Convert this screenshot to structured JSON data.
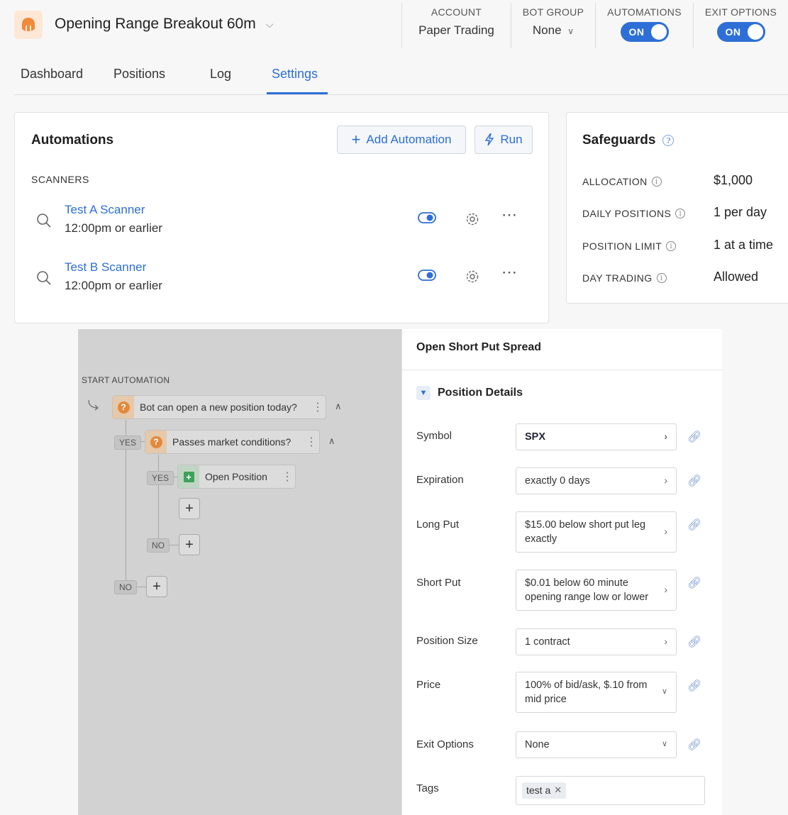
{
  "bot": {
    "name": "Opening Range Breakout 60m"
  },
  "header": {
    "account": {
      "label": "ACCOUNT",
      "value": "Paper Trading"
    },
    "bot_group": {
      "label": "BOT GROUP",
      "value": "None"
    },
    "automations": {
      "label": "AUTOMATIONS",
      "state": "ON"
    },
    "exit_options": {
      "label": "EXIT OPTIONS",
      "state": "ON"
    }
  },
  "tabs": [
    "Dashboard",
    "Positions",
    "Log",
    "Settings"
  ],
  "active_tab": "Settings",
  "automations_card": {
    "title": "Automations",
    "add_label": "Add Automation",
    "run_label": "Run",
    "section": "SCANNERS",
    "scanners": [
      {
        "name": "Test A Scanner",
        "schedule": "12:00pm or earlier"
      },
      {
        "name": "Test B Scanner",
        "schedule": "12:00pm or earlier"
      }
    ]
  },
  "safeguards": {
    "title": "Safeguards",
    "rows": [
      {
        "label": "ALLOCATION",
        "value": "$1,000"
      },
      {
        "label": "DAILY POSITIONS",
        "value": "1 per day"
      },
      {
        "label": "POSITION LIMIT",
        "value": "1 at a time"
      },
      {
        "label": "DAY TRADING",
        "value": "Allowed"
      }
    ]
  },
  "flow": {
    "start_label": "START AUTOMATION",
    "node1": "Bot can open a new position today?",
    "node2": "Passes market conditions?",
    "node3": "Open Position",
    "yes": "YES",
    "no": "NO"
  },
  "details": {
    "title": "Open Short Put Spread",
    "section": "Position Details",
    "fields": [
      {
        "label": "Symbol",
        "value": "SPX"
      },
      {
        "label": "Expiration",
        "value": "exactly 0 days"
      },
      {
        "label": "Long Put",
        "value": "$15.00 below short put leg exactly"
      },
      {
        "label": "Short Put",
        "value": "$0.01 below 60 minute opening range low or lower"
      },
      {
        "label": "Position Size",
        "value": "1 contract"
      },
      {
        "label": "Price",
        "value": "100% of bid/ask, $.10 from mid price"
      },
      {
        "label": "Exit Options",
        "value": "None"
      },
      {
        "label": "Tags",
        "value": "test a"
      }
    ]
  },
  "colors": {
    "accent": "#2d6fd6",
    "logo_bg": "#fde7d6",
    "logo_fg": "#f08a3c"
  }
}
